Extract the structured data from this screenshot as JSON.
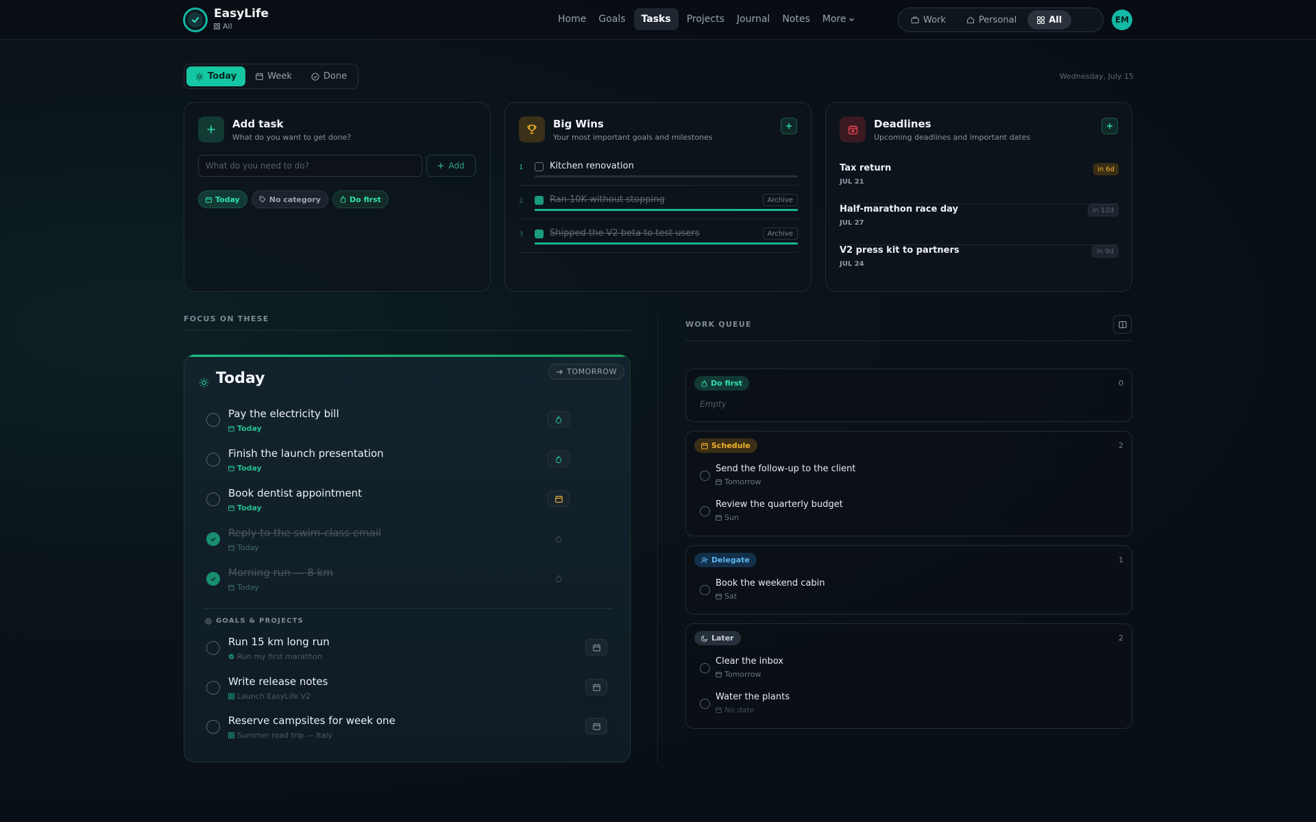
{
  "app": {
    "name": "EasyLife",
    "context_label": "All",
    "avatar_initials": "EM"
  },
  "nav": {
    "items": [
      "Home",
      "Goals",
      "Tasks",
      "Projects",
      "Journal",
      "Notes"
    ],
    "more": "More",
    "active": "Tasks"
  },
  "contexts": {
    "items": [
      "Work",
      "Personal",
      "All"
    ],
    "active": "All"
  },
  "view_tabs": {
    "items": [
      "Today",
      "Week",
      "Done"
    ],
    "active": "Today"
  },
  "date": "Wednesday, July 15",
  "add_task": {
    "title": "Add task",
    "subtitle": "What do you want to get done?",
    "placeholder": "What do you need to do?",
    "button": "Add",
    "chips": [
      "Today",
      "No category",
      "Do first"
    ]
  },
  "big_wins": {
    "title": "Big Wins",
    "subtitle": "Your most important goals and milestones",
    "items": [
      {
        "num": "1",
        "text": "Kitchen renovation",
        "done": false,
        "progress": 0
      },
      {
        "num": "2",
        "text": "Ran 10K without stopping",
        "done": true,
        "progress": 1,
        "action": "Archive"
      },
      {
        "num": "3",
        "text": "Shipped the V2 beta to test users",
        "done": true,
        "progress": 1,
        "action": "Archive"
      }
    ]
  },
  "deadlines": {
    "title": "Deadlines",
    "subtitle": "Upcoming deadlines and important dates",
    "items": [
      {
        "title": "Tax return",
        "date": "JUL 21",
        "badge": "in 6d",
        "urgent": true
      },
      {
        "title": "Half-marathon race day",
        "date": "JUL 27",
        "badge": "in 12d",
        "urgent": false
      },
      {
        "title": "V2 press kit to partners",
        "date": "JUL 24",
        "badge": "in 9d",
        "urgent": false
      }
    ]
  },
  "focus": {
    "section_label": "FOCUS ON THESE",
    "panel_title": "Today",
    "tomorrow_button": "TOMORROW",
    "tasks": [
      {
        "name": "Pay the electricity bill",
        "meta": "Today",
        "done": false,
        "action_icon": "flame-icon"
      },
      {
        "name": "Finish the launch presentation",
        "meta": "Today",
        "done": false,
        "action_icon": "flame-icon"
      },
      {
        "name": "Book dentist appointment",
        "meta": "Today",
        "done": false,
        "action_icon": "calendar-icon"
      },
      {
        "name": "Reply to the swim-class email",
        "meta": "Today",
        "done": true,
        "action_icon": "flame-icon"
      },
      {
        "name": "Morning run — 8 km",
        "meta": "Today",
        "done": true,
        "action_icon": "flame-icon"
      }
    ],
    "goals_label": "GOALS & PROJECTS",
    "goal_tasks": [
      {
        "name": "Run 15 km long run",
        "meta": "Run my first marathon"
      },
      {
        "name": "Write release notes",
        "meta": "Launch EasyLife V2"
      },
      {
        "name": "Reserve campsites for week one",
        "meta": "Summer road trip — Italy"
      }
    ]
  },
  "queue": {
    "section_label": "WORK QUEUE",
    "groups": [
      {
        "label": "Do first",
        "count": "0",
        "empty_text": "Empty",
        "items": []
      },
      {
        "label": "Schedule",
        "count": "2",
        "items": [
          {
            "name": "Send the follow-up to the client",
            "meta": "Tomorrow"
          },
          {
            "name": "Review the quarterly budget",
            "meta": "Sun"
          }
        ]
      },
      {
        "label": "Delegate",
        "count": "1",
        "items": [
          {
            "name": "Book the weekend cabin",
            "meta": "Sat"
          }
        ]
      },
      {
        "label": "Later",
        "count": "2",
        "items": [
          {
            "name": "Clear the inbox",
            "meta": "Tomorrow"
          },
          {
            "name": "Water the plants",
            "meta": "No date"
          }
        ]
      }
    ]
  },
  "colors": {
    "accent": "#14c6a1",
    "urgent": "#f5b331",
    "danger": "#e2434f"
  }
}
